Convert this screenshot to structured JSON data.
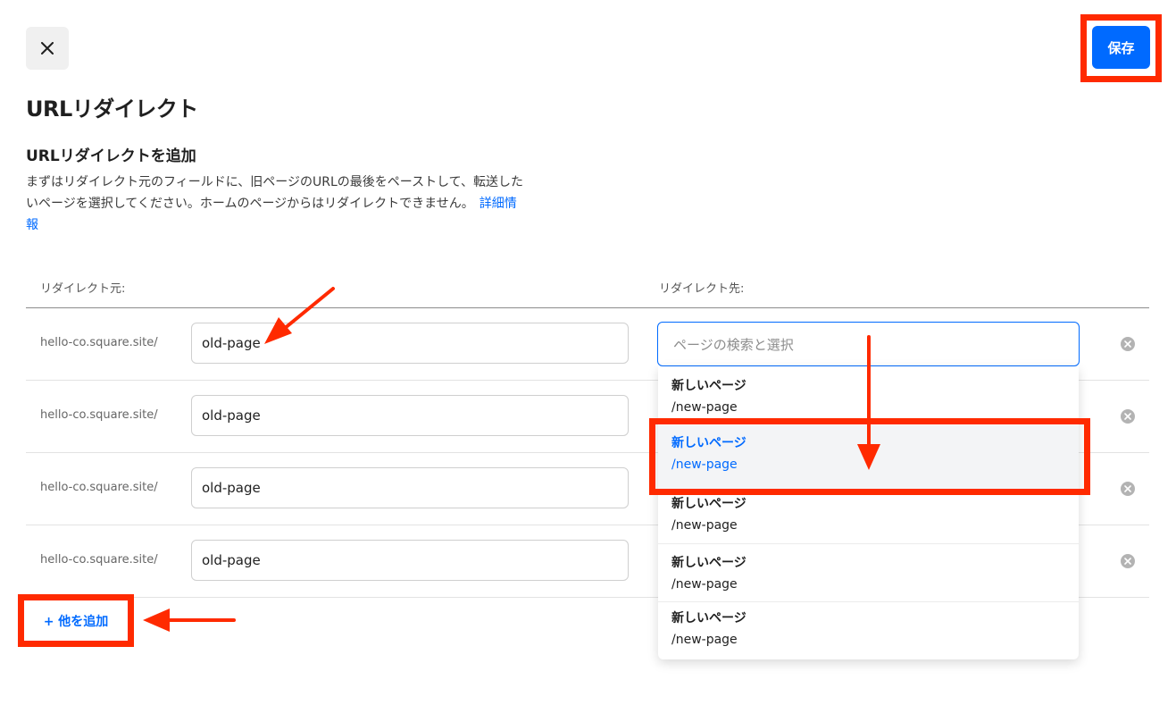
{
  "header": {
    "close_icon": "close-icon",
    "save_label": "保存"
  },
  "page": {
    "title": "URLリダイレクト",
    "section_title": "URLリダイレクトを追加",
    "description": "まずはリダイレクト元のフィールドに、旧ページのURLの最後をペーストして、転送したいページを選択してください。ホームのページからはリダイレクトできません。",
    "more_info_link": "詳細情報"
  },
  "table": {
    "col_from": "リダイレクト元:",
    "col_to": "リダイレクト先:",
    "rows": [
      {
        "domain": "hello-co.square.site/",
        "from": "old-page"
      },
      {
        "domain": "hello-co.square.site/",
        "from": "old-page"
      },
      {
        "domain": "hello-co.square.site/",
        "from": "old-page"
      },
      {
        "domain": "hello-co.square.site/",
        "from": "old-page"
      }
    ],
    "destination": {
      "placeholder": "ページの検索と選択",
      "options": [
        {
          "title": "新しいページ",
          "path": "/new-page",
          "selected": false
        },
        {
          "title": "新しいページ",
          "path": "/new-page",
          "selected": true
        },
        {
          "title": "新しいページ",
          "path": "/new-page",
          "selected": false
        },
        {
          "title": "新しいページ",
          "path": "/new-page",
          "selected": false
        },
        {
          "title": "新しいページ",
          "path": "/new-page",
          "selected": false
        }
      ]
    }
  },
  "add_more_label": "+ 他を追加",
  "colors": {
    "accent": "#006aff",
    "annotation": "#ff2a00"
  }
}
